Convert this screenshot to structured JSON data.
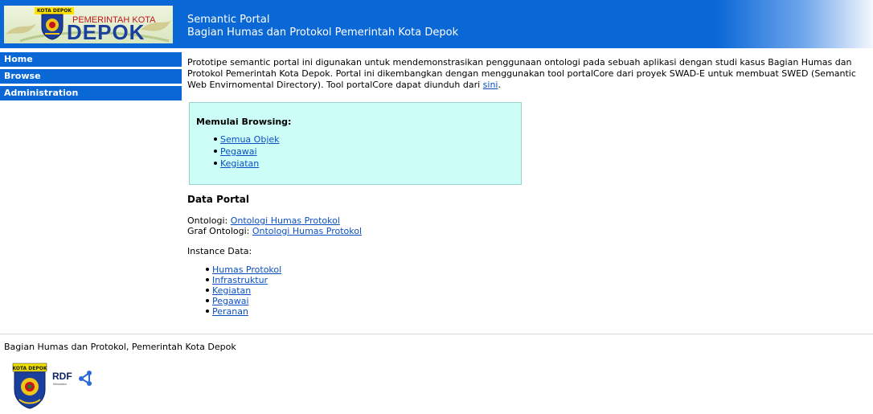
{
  "header": {
    "logo_tag": "KOTA DEPOK",
    "logo_line1": "PEMERINTAH KOTA",
    "logo_line2": "DEPOK",
    "title_line1": "Semantic Portal",
    "title_line2": "Bagian Humas dan Protokol Pemerintah Kota Depok"
  },
  "nav": {
    "items": [
      {
        "label": "Home"
      },
      {
        "label": "Browse"
      },
      {
        "label": "Administration"
      }
    ]
  },
  "main": {
    "intro_text": "Prototipe semantic portal ini digunakan untuk mendemonstrasikan penggunaan ontologi pada sebuah aplikasi dengan studi kasus Bagian Humas dan Protokol Pemerintah Kota Depok. Portal ini dikembangkan dengan menggunakan tool portalCore dari proyek SWAD-E untuk membuat SWED (Semantic Web Envirnomental Directory). Tool portalCore dapat diunduh dari ",
    "intro_link": "sini",
    "intro_end": ".",
    "browse": {
      "title": "Memulai Browsing:",
      "links": [
        "Semua Objek",
        "Pegawai",
        "Kegiatan"
      ]
    },
    "data_portal": {
      "title": "Data Portal",
      "ontologi_label": "Ontologi: ",
      "ontologi_link": "Ontologi Humas Protokol",
      "graf_label": "Graf Ontologi: ",
      "graf_link": "Ontologi Humas Protokol",
      "instance_title": "Instance Data:",
      "instances": [
        "Humas Protokol",
        "Infrastruktur",
        "Kegiatan",
        "Pegawai",
        "Peranan"
      ]
    }
  },
  "footer": {
    "text": "Bagian Humas dan Protokol, Pemerintah Kota Depok",
    "emblem_tag": "KOTA DEPOK",
    "rdf_label": "RDF",
    "rdf_sub": "Metadata"
  },
  "colors": {
    "brand_blue": "#0a67d6",
    "browse_box_bg": "#ccfdf7",
    "link": "#0b4fc4"
  }
}
